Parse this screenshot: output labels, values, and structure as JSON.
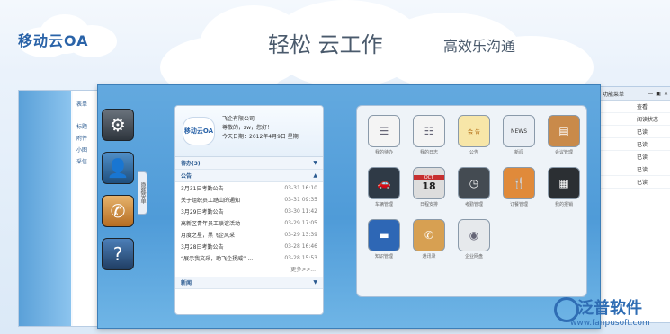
{
  "brand": {
    "name": "移动云OA"
  },
  "header": {
    "slogan": "轻松 云工作",
    "slogan2": "高效乐沟通"
  },
  "left_window": {
    "items": [
      "标题",
      "附件",
      "小图",
      "采信"
    ],
    "top_label": "表单"
  },
  "right_window": {
    "toolbar_label": "功能菜单",
    "column": "查看",
    "items": [
      "阅读状态",
      "已读",
      "已读",
      "已读",
      "已读",
      "已读"
    ]
  },
  "panel": {
    "company": "飞企有限公司",
    "greeting": "尊敬的，zw，您好！",
    "date": "今天日期：2012年4月9日 星期一",
    "logo_text": "移动云OA",
    "sections": {
      "todo": "待办(3)",
      "notice": "公告",
      "news": "新闻"
    },
    "notices": [
      {
        "title": "3月31日考勤公告",
        "date": "03-31 16:10"
      },
      {
        "title": "关于组织员工踏山的通知",
        "date": "03-31 09:35"
      },
      {
        "title": "3月29日考勤公告",
        "date": "03-30 11:42"
      },
      {
        "title": "高新区青年员工联谊活动",
        "date": "03-29 17:05"
      },
      {
        "title": "月度之星，黑飞企风采",
        "date": "03-29 13:39"
      },
      {
        "title": "3月28日考勤公告",
        "date": "03-28 16:46"
      },
      {
        "title": "“展示我文采，助飞企扬威”-...",
        "date": "03-28 15:53"
      }
    ],
    "more": "更多>>..."
  },
  "side_tab": {
    "label": "隐藏菜单"
  },
  "apps": [
    {
      "label": "我的待办",
      "icon": "checklist-icon",
      "color": "#f4f4f4"
    },
    {
      "label": "我的日志",
      "icon": "calendar-list-icon",
      "color": "#f4f4f4"
    },
    {
      "label": "公告",
      "icon": "notice-icon",
      "color": "#f7e6a8"
    },
    {
      "label": "新闻",
      "icon": "news-icon",
      "color": "#e9eef4"
    },
    {
      "label": "会议管理",
      "icon": "meeting-icon",
      "color": "#c98a4a"
    },
    {
      "label": "车辆管理",
      "icon": "car-icon",
      "color": "#2f3a46"
    },
    {
      "label": "日程安排",
      "icon": "calendar-icon",
      "color": "#dddddd"
    },
    {
      "label": "考勤管理",
      "icon": "clock-icon",
      "color": "#444b52"
    },
    {
      "label": "订餐管理",
      "icon": "dining-icon",
      "color": "#e08a3a"
    },
    {
      "label": "我的报销",
      "icon": "calculator-icon",
      "color": "#2b2f33"
    },
    {
      "label": "知识管理",
      "icon": "folder-icon",
      "color": "#2e67b5"
    },
    {
      "label": "通讯录",
      "icon": "address-book-icon",
      "color": "#d7a052"
    },
    {
      "label": "企业网盘",
      "icon": "disk-icon",
      "color": "#e6e9ec"
    }
  ],
  "calendar_tile": {
    "month": "OCT",
    "day": "18"
  },
  "news_tile": {
    "text": "NEWS"
  },
  "notice_tile": {
    "text": "会 告"
  },
  "watermark": {
    "name": "泛普软件",
    "url": "www.fanpusoft.com"
  }
}
